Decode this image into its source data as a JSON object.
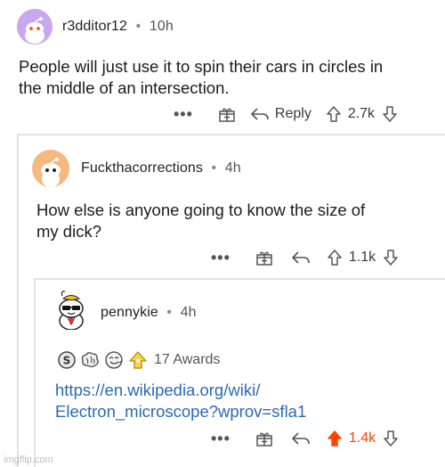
{
  "comments": [
    {
      "username": "r3dditor12",
      "time": "10h",
      "body_lines": [
        "People will just use it to spin their cars in circles in",
        "the middle of an intersection."
      ],
      "actions": {
        "more": "•••",
        "reply": "Reply",
        "votes": "2.7k"
      }
    },
    {
      "username": "Fuckthacorrections",
      "time": "4h",
      "body_lines": [
        "How else is anyone going to know the size of",
        "my dick?"
      ],
      "actions": {
        "more": "•••",
        "votes": "1.1k"
      }
    },
    {
      "username": "pennykie",
      "time": "4h",
      "awards_label": "17 Awards",
      "link_lines": [
        "https://en.wikipedia.org/wiki/",
        "Electron_microscope?wprov=sfla1"
      ],
      "actions": {
        "more": "•••",
        "votes": "1.4k"
      }
    }
  ],
  "separator": "•",
  "watermark": "imgflip.com",
  "colors": {
    "upvote_active": "#ff4500",
    "link": "#2b69b5",
    "thread_line": "#e2e2e2"
  }
}
